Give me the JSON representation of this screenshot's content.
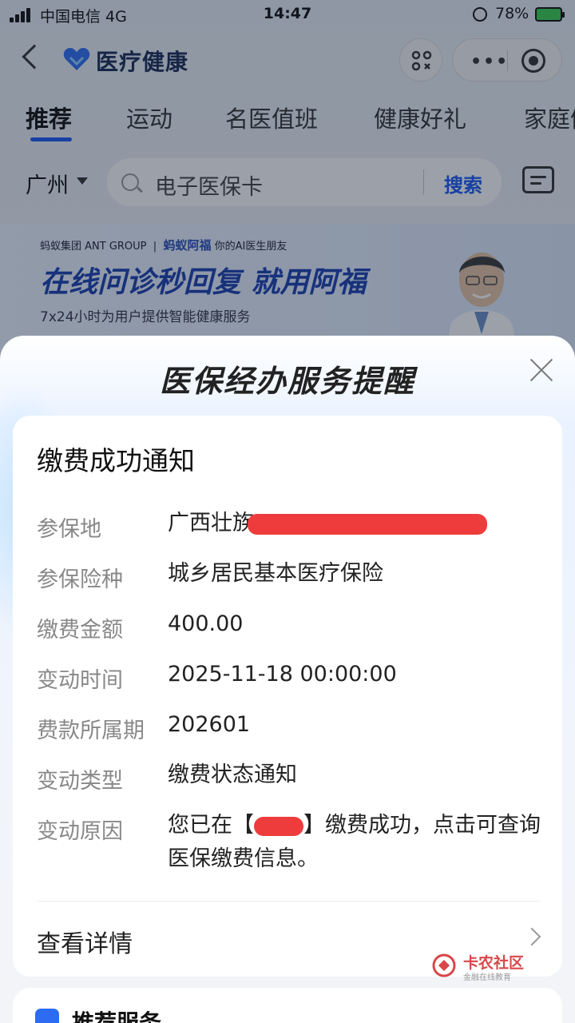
{
  "status_bar": {
    "carrier": "中国电信  4G",
    "time": "14:47",
    "battery": "78%"
  },
  "nav": {
    "title": "医疗健康"
  },
  "tabs": [
    "推荐",
    "运动",
    "名医值班",
    "健康好礼",
    "家庭健康"
  ],
  "search": {
    "city": "广州",
    "placeholder": "电子医保卡",
    "button": "搜索"
  },
  "banner": {
    "brand_group": "蚂蚁集团 ANT GROUP",
    "brand_product": "蚂蚁阿福",
    "brand_slogan": "你的AI医生朋友",
    "headline": "在线问诊秒回复 就用阿福",
    "subline": "7x24小时为用户提供智能健康服务"
  },
  "modal": {
    "title": "医保经办服务提醒",
    "card_title": "缴费成功通知",
    "fields": [
      {
        "label": "参保地",
        "value": "广西壮族"
      },
      {
        "label": "参保险种",
        "value": "城乡居民基本医疗保险"
      },
      {
        "label": "缴费金额",
        "value": "400.00"
      },
      {
        "label": "变动时间",
        "value": "2025-11-18 00:00:00"
      },
      {
        "label": "费款所属期",
        "value": "202601"
      },
      {
        "label": "变动类型",
        "value": "缴费状态通知"
      },
      {
        "label": "变动原因",
        "value_prefix": "您已在【",
        "value_suffix": "】缴费成功，点击可查询医保缴费信息。"
      }
    ],
    "detail_link": "查看详情"
  },
  "watermark": {
    "name": "卡农社区",
    "sub": "金融在线教育"
  },
  "next_section": {
    "title": "推荐服务"
  },
  "colors": {
    "accent": "#1a59f3",
    "redaction": "#ee3b3b",
    "title_text": "#222222"
  }
}
